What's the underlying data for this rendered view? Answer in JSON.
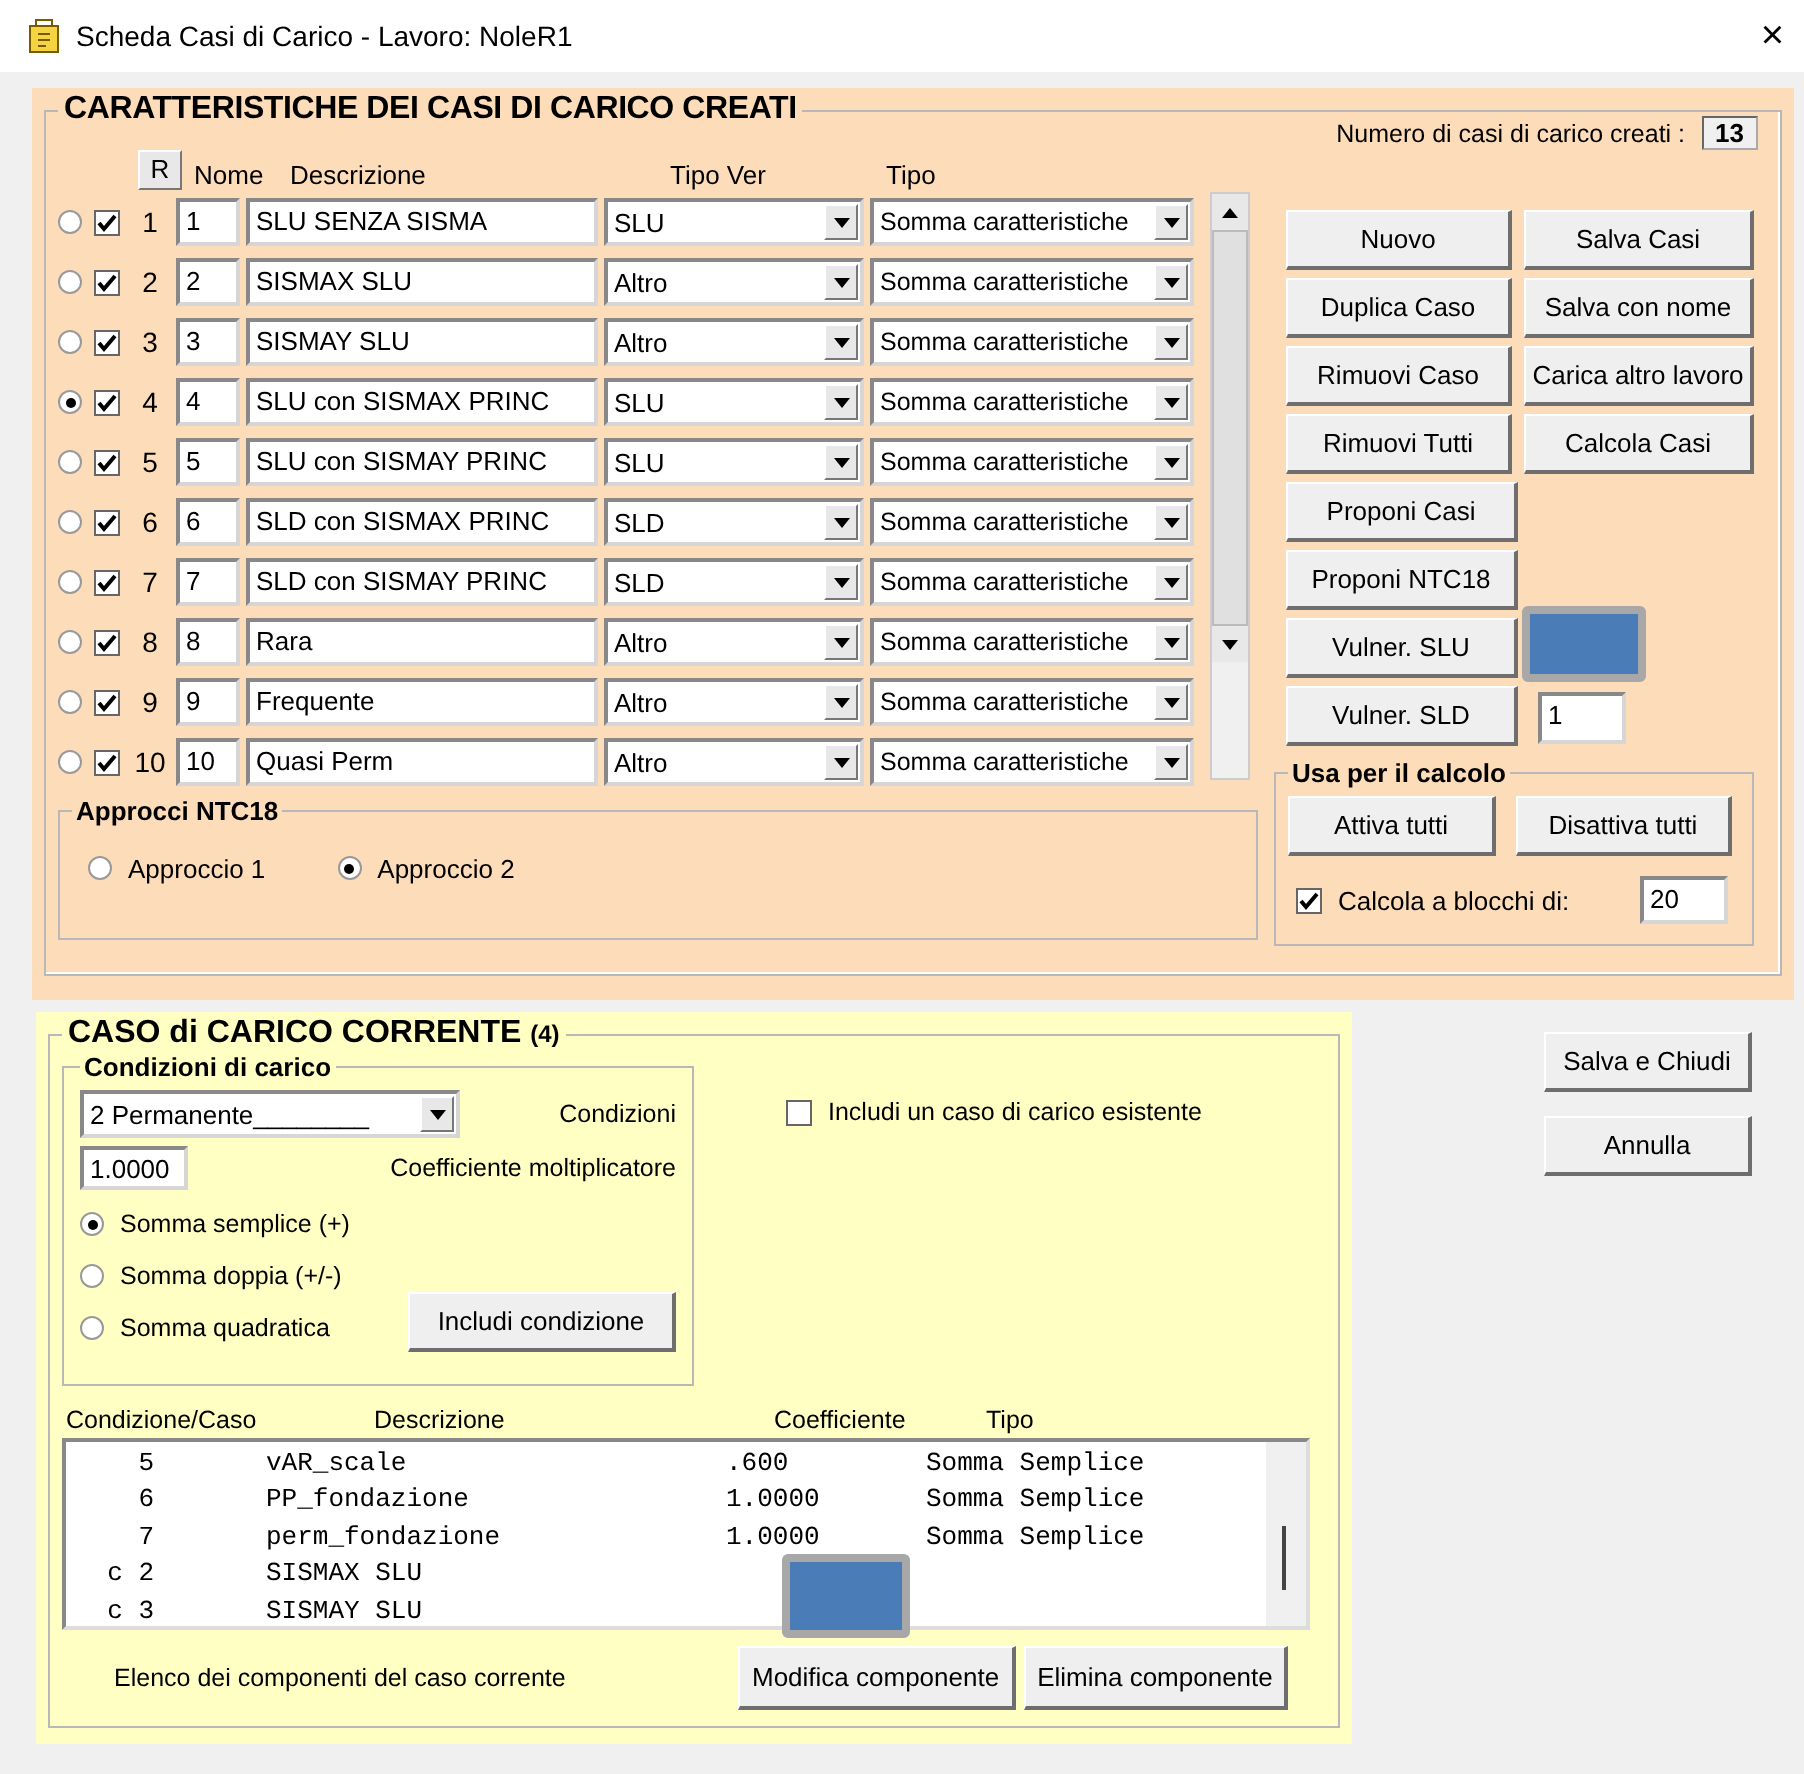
{
  "window": {
    "title": "Scheda Casi di Carico - Lavoro: NoleR1",
    "close": "×"
  },
  "casi": {
    "title": "CARATTERISTICHE DEI CASI DI CARICO CREATI",
    "count_label": "Numero di casi di carico creati :",
    "count": "13",
    "r_button": "R",
    "columns": [
      "Nome",
      "Descrizione",
      "Tipo Ver",
      "Tipo"
    ],
    "rows": [
      {
        "selected": false,
        "checked": true,
        "index": "1",
        "nome": "1",
        "descrizione": "SLU SENZA SISMA",
        "tipo_ver": "SLU",
        "tipo": "Somma caratteristiche"
      },
      {
        "selected": false,
        "checked": true,
        "index": "2",
        "nome": "2",
        "descrizione": "SISMAX SLU",
        "tipo_ver": "Altro",
        "tipo": "Somma caratteristiche"
      },
      {
        "selected": false,
        "checked": true,
        "index": "3",
        "nome": "3",
        "descrizione": "SISMAY SLU",
        "tipo_ver": "Altro",
        "tipo": "Somma caratteristiche"
      },
      {
        "selected": true,
        "checked": true,
        "index": "4",
        "nome": "4",
        "descrizione": "SLU con SISMAX PRINC",
        "tipo_ver": "SLU",
        "tipo": "Somma caratteristiche"
      },
      {
        "selected": false,
        "checked": true,
        "index": "5",
        "nome": "5",
        "descrizione": "SLU con SISMAY PRINC",
        "tipo_ver": "SLU",
        "tipo": "Somma caratteristiche"
      },
      {
        "selected": false,
        "checked": true,
        "index": "6",
        "nome": "6",
        "descrizione": "SLD con SISMAX PRINC",
        "tipo_ver": "SLD",
        "tipo": "Somma caratteristiche"
      },
      {
        "selected": false,
        "checked": true,
        "index": "7",
        "nome": "7",
        "descrizione": "SLD con SISMAY PRINC",
        "tipo_ver": "SLD",
        "tipo": "Somma caratteristiche"
      },
      {
        "selected": false,
        "checked": true,
        "index": "8",
        "nome": "8",
        "descrizione": "Rara",
        "tipo_ver": "Altro",
        "tipo": "Somma caratteristiche"
      },
      {
        "selected": false,
        "checked": true,
        "index": "9",
        "nome": "9",
        "descrizione": "Frequente",
        "tipo_ver": "Altro",
        "tipo": "Somma caratteristiche"
      },
      {
        "selected": false,
        "checked": true,
        "index": "10",
        "nome": "10",
        "descrizione": "Quasi Perm",
        "tipo_ver": "Altro",
        "tipo": "Somma caratteristiche"
      }
    ],
    "approcci": {
      "title": "Approcci NTC18",
      "options": [
        {
          "label": "Approccio 1",
          "selected": false
        },
        {
          "label": "Approccio 2",
          "selected": true
        }
      ]
    },
    "buttons": [
      [
        "Nuovo",
        "Salva Casi"
      ],
      [
        "Duplica Caso",
        "Salva con nome"
      ],
      [
        "Rimuovi Caso",
        "Carica altro lavoro"
      ],
      [
        "Rimuovi Tutti",
        "Calcola Casi"
      ],
      [
        "Proponi Casi"
      ],
      [
        "Proponi NTC18"
      ]
    ],
    "vulner_slu": "Vulner. SLU",
    "vulner_sld": "Vulner. SLD",
    "vulner_value": "1",
    "usa": {
      "title": "Usa per il calcolo",
      "buttons": [
        "Attiva tutti",
        "Disattiva tutti"
      ],
      "checkbox": {
        "label": "Calcola a blocchi di:",
        "checked": true
      },
      "value": "20"
    }
  },
  "corrente": {
    "title": "CASO di CARICO CORRENTE",
    "badge": "(4)",
    "condizioni": {
      "title": "Condizioni di carico",
      "select": "2  Permanente________",
      "select_label": "Condizioni",
      "coefficient": "1.0000",
      "coefficient_label": "Coefficiente moltiplicatore",
      "options": [
        {
          "label": "Somma semplice (+)",
          "selected": true
        },
        {
          "label": "Somma doppia (+/-)",
          "selected": false
        },
        {
          "label": "Somma quadratica",
          "selected": false
        }
      ],
      "button": "Includi condizione"
    },
    "include": {
      "label": "Includi un caso di carico esistente",
      "checked": false
    },
    "columns": [
      "Condizione/Caso",
      "Descrizione",
      "Coefficiente",
      "Tipo"
    ],
    "rows": [
      {
        "condizione": "5",
        "descrizione": "vAR_scale",
        "coefficiente": ".600",
        "tipo": "Somma Semplice"
      },
      {
        "condizione": "6",
        "descrizione": "PP_fondazione",
        "coefficiente": "1.0000",
        "tipo": "Somma Semplice"
      },
      {
        "condizione": "7",
        "descrizione": "perm_fondazione",
        "coefficiente": "1.0000",
        "tipo": "Somma Semplice"
      },
      {
        "condizione": "c 2",
        "descrizione": "SISMAX SLU",
        "coefficiente": "",
        "tipo": ""
      },
      {
        "condizione": "c 3",
        "descrizione": "SISMAY SLU",
        "coefficiente": "",
        "tipo": ""
      }
    ],
    "footer": "Elenco dei componenti del caso corrente",
    "buttons": [
      "Modifica componente",
      "Elimina componente"
    ]
  },
  "side_buttons": [
    "Salva e Chiudi",
    "Annulla"
  ]
}
